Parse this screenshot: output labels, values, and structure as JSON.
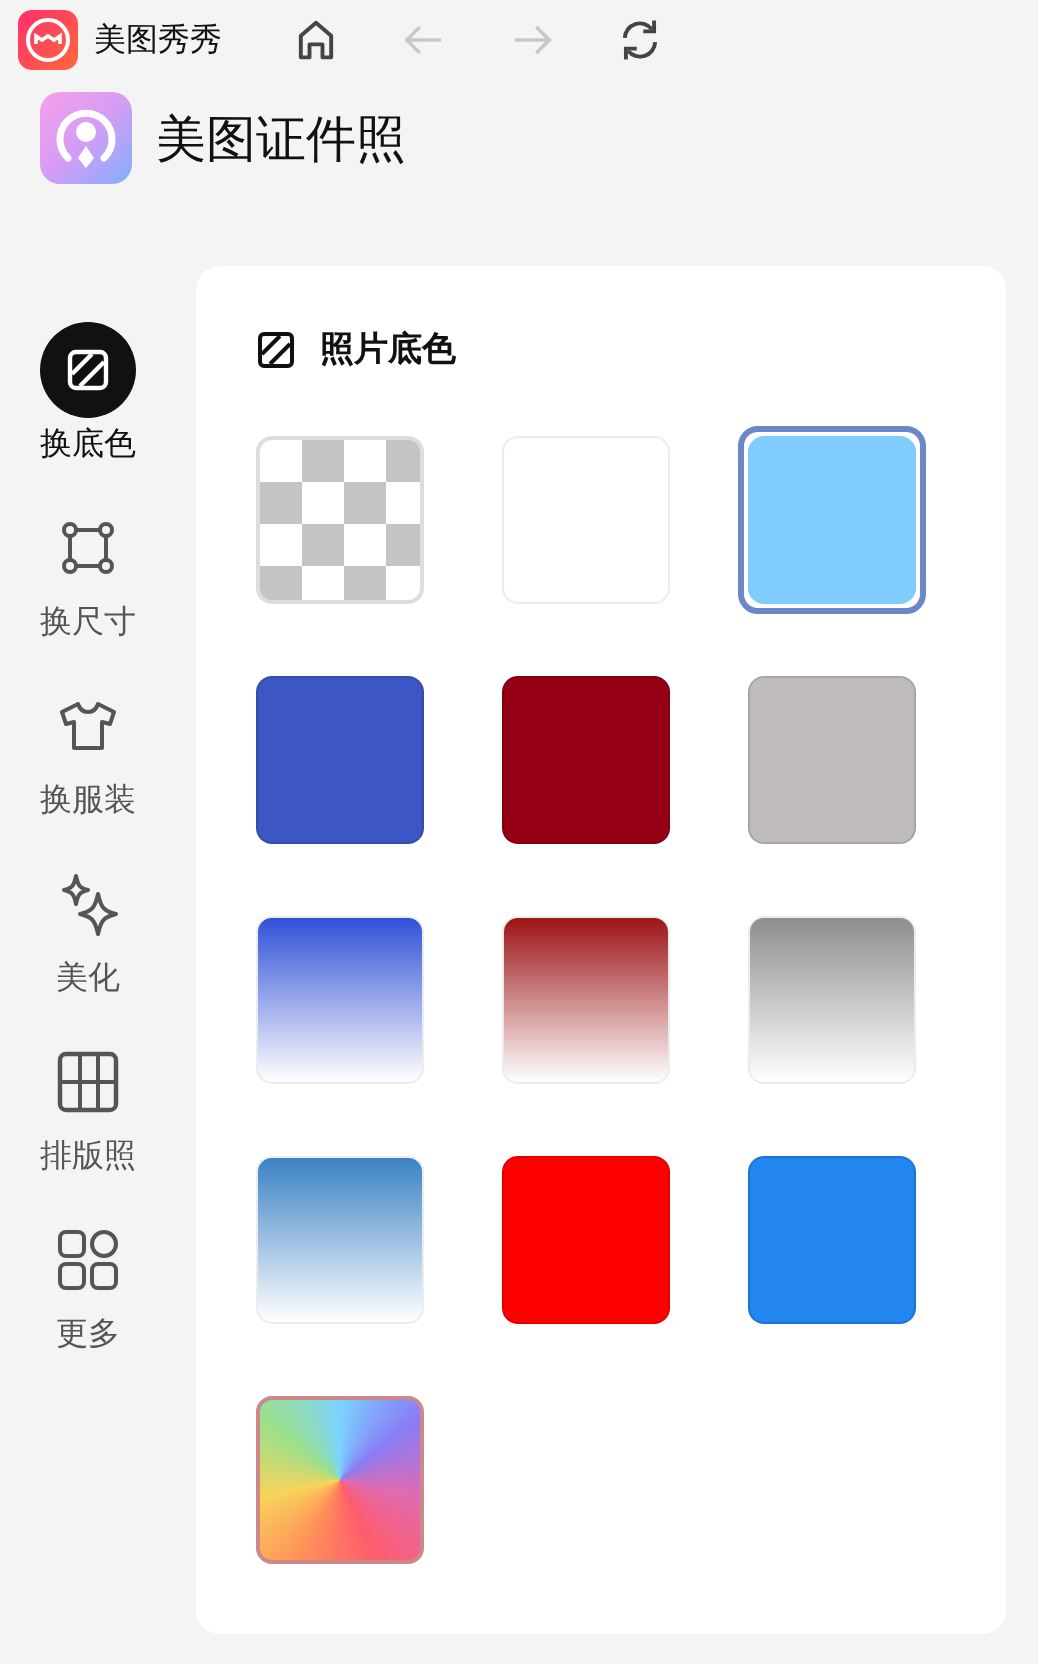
{
  "top_bar": {
    "app_name": "美图秀秀",
    "tools": [
      {
        "kind": "home",
        "disabled": false
      },
      {
        "kind": "back",
        "disabled": true
      },
      {
        "kind": "forward",
        "disabled": true
      },
      {
        "kind": "refresh",
        "disabled": false
      }
    ]
  },
  "header": {
    "title": "美图证件照"
  },
  "sidebar": {
    "items": [
      {
        "label": "换底色",
        "selected": true
      },
      {
        "label": "换尺寸",
        "selected": false
      },
      {
        "label": "换服装",
        "selected": false
      },
      {
        "label": "美化",
        "selected": false
      },
      {
        "label": "排版照",
        "selected": false
      },
      {
        "label": "更多",
        "selected": false
      }
    ]
  },
  "panel": {
    "title": "照片底色",
    "swatches": [
      {
        "kind": "transparent",
        "selected": false
      },
      {
        "kind": "solid",
        "color": "#ffffff",
        "selected": false
      },
      {
        "kind": "solid",
        "color": "#80ccff",
        "selected": true
      },
      {
        "kind": "solid",
        "color": "#3c57c4",
        "selected": false
      },
      {
        "kind": "solid",
        "color": "#960014",
        "selected": false
      },
      {
        "kind": "solid",
        "color": "#c0bcbc",
        "selected": false
      },
      {
        "kind": "gradient",
        "color": "#3151d8",
        "selected": false
      },
      {
        "kind": "gradient",
        "color": "#9c1416",
        "selected": false
      },
      {
        "kind": "gradient",
        "color": "#8e8e8e",
        "selected": false
      },
      {
        "kind": "gradient",
        "color": "#3b82c4",
        "selected": false
      },
      {
        "kind": "solid",
        "color": "#ff0000",
        "selected": false
      },
      {
        "kind": "solid",
        "color": "#2286ee",
        "selected": false
      },
      {
        "kind": "rainbow",
        "selected": false
      }
    ]
  }
}
